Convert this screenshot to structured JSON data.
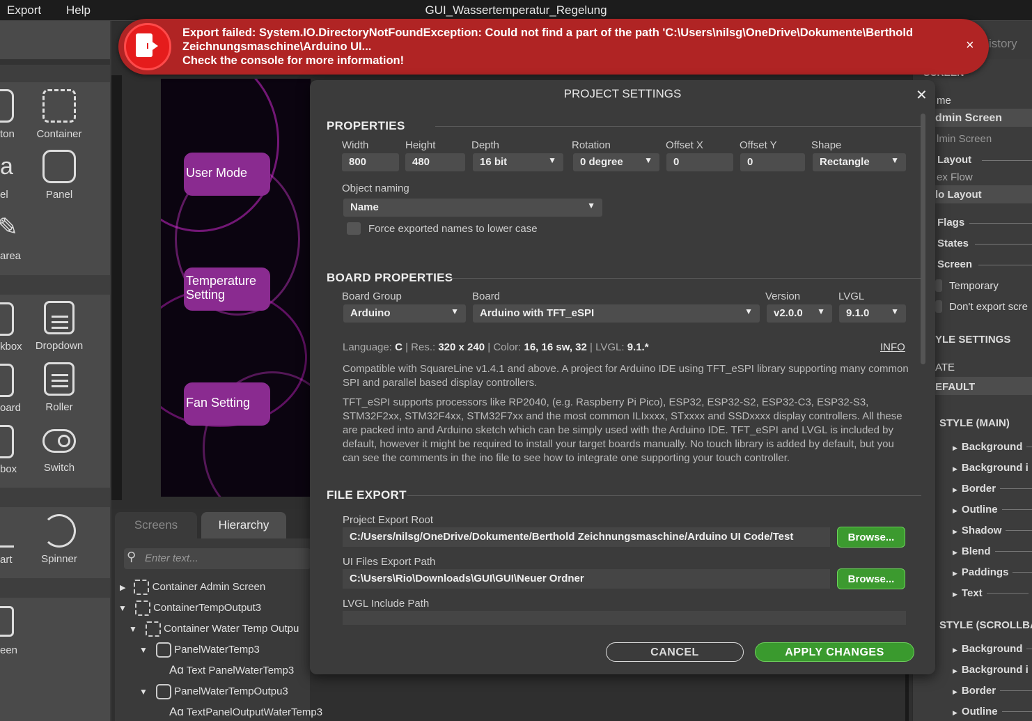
{
  "menubar": {
    "export": "Export",
    "help": "Help",
    "title": "GUI_Wassertemperatur_Regelung"
  },
  "widgets": {
    "button_cut": "ton",
    "container": "Container",
    "label_cut": "el",
    "panel": "Panel",
    "textarea_cut": "area",
    "checkbox_cut": "kbox",
    "dropdown": "Dropdown",
    "keyboard_cut": "oard",
    "roller": "Roller",
    "spinbox_cut": "box",
    "switch": "Switch",
    "chart_cut": "art",
    "spinner": "Spinner",
    "screen_cut": "een"
  },
  "preview": {
    "btn1": "User Mode",
    "btn2": "Temperature Setting",
    "btn3": "Fan Setting",
    "bg_accent": "#8a2b90"
  },
  "hierarchy": {
    "tab_screens": "Screens",
    "tab_hierarchy": "Hierarchy",
    "search_placeholder": "Enter text...",
    "rows": [
      "Container Admin Screen",
      "ContainerTempOutput3",
      "Container Water Temp Outpu",
      "PanelWaterTemp3",
      "Text PanelWaterTemp3",
      "PanelWaterTempOutpu3",
      "TextPanelOutputWaterTemp3"
    ]
  },
  "toast": {
    "line1": "Export failed: System.IO.DirectoryNotFoundException: Could not find a part of the path 'C:\\Users\\nilsg\\OneDrive\\Dokumente\\Berthold",
    "line2": "Zeichnungsmaschine\\Arduino UI...",
    "line3": "Check the console for more information!",
    "close": "×",
    "color": "#b02424"
  },
  "inspector": {
    "history_cut": "istory",
    "screen_cut": "SCREEN",
    "name_cut": "me",
    "name_value_cut": "dmin Screen",
    "name_ph_cut": "lmin Screen",
    "layout": "Layout",
    "flex_cut": "ex Flow",
    "nolayout_cut": "lo Layout",
    "flags": "Flags",
    "states": "States",
    "screen": "Screen",
    "temporary": "Temporary",
    "dont_export": "Don't export scre",
    "style_settings_cut": "YLE SETTINGS",
    "state_cut": "ATE",
    "default_cut": "EFAULT",
    "style_main": "STYLE (MAIN)",
    "main_items": [
      "Background",
      "Background i",
      "Border",
      "Outline",
      "Shadow",
      "Blend",
      "Paddings",
      "Text"
    ],
    "style_scrollbar": "STYLE (SCROLLBAR",
    "scroll_items": [
      "Background",
      "Background i",
      "Border",
      "Outline"
    ]
  },
  "dialog": {
    "title": "PROJECT SETTINGS",
    "close": "✕",
    "properties": {
      "heading": "PROPERTIES",
      "width_label": "Width",
      "width": "800",
      "height_label": "Height",
      "height": "480",
      "depth_label": "Depth",
      "depth": "16 bit",
      "rotation_label": "Rotation",
      "rotation": "0 degree",
      "offx_label": "Offset X",
      "offx": "0",
      "offy_label": "Offset Y",
      "offy": "0",
      "shape_label": "Shape",
      "shape": "Rectangle",
      "naming_label": "Object naming",
      "naming": "Name",
      "force_lower": "Force exported names to lower case",
      "force_lower_checked": false
    },
    "board": {
      "heading": "BOARD PROPERTIES",
      "group_label": "Board Group",
      "group": "Arduino",
      "board_label": "Board",
      "board": "Arduino with TFT_eSPI",
      "version_label": "Version",
      "version": "v2.0.0",
      "lvgl_label": "LVGL",
      "lvgl": "9.1.0",
      "lang_label": "Language:",
      "lang": "C",
      "res_label": "Res.:",
      "res": "320 x 240",
      "color_label": "Color:",
      "color": "16, 16 sw, 32",
      "lvgl2_label": "LVGL:",
      "lvgl2": "9.1.*",
      "info": "INFO",
      "desc1": "Compatible with SquareLine v1.4.1 and above. A project for Arduino IDE using TFT_eSPI library supporting many common SPI and parallel based display controllers.",
      "desc2": "TFT_eSPI supports processors like RP2040, (e.g. Raspberry Pi Pico), ESP32, ESP32-S2, ESP32-C3, ESP32-S3, STM32F2xx, STM32F4xx, STM32F7xx and the most common ILIxxxx, STxxxx and SSDxxxx display controllers. All these are packed into and Arduino sketch which can be simply used with the Arduino IDE. TFT_eSPI and LVGL is included by default, however it might be required to install your target boards manually.  No touch library is added by default, but you can see the comments in the ino file to see how to integrate one supporting your touch controller."
    },
    "file_export": {
      "heading": "FILE EXPORT",
      "root_label": "Project Export Root",
      "root": "C:/Users/nilsg/OneDrive/Dokumente/Berthold Zeichnungsmaschine/Arduino UI Code/Test",
      "ui_label": "UI Files Export Path",
      "ui": "C:\\Users\\Rio\\Downloads\\GUI\\GUI\\Neuer Ordner",
      "lvgl_label": "LVGL Include Path",
      "lvgl": "",
      "browse": "Browse..."
    },
    "cancel": "CANCEL",
    "apply": "APPLY CHANGES"
  }
}
